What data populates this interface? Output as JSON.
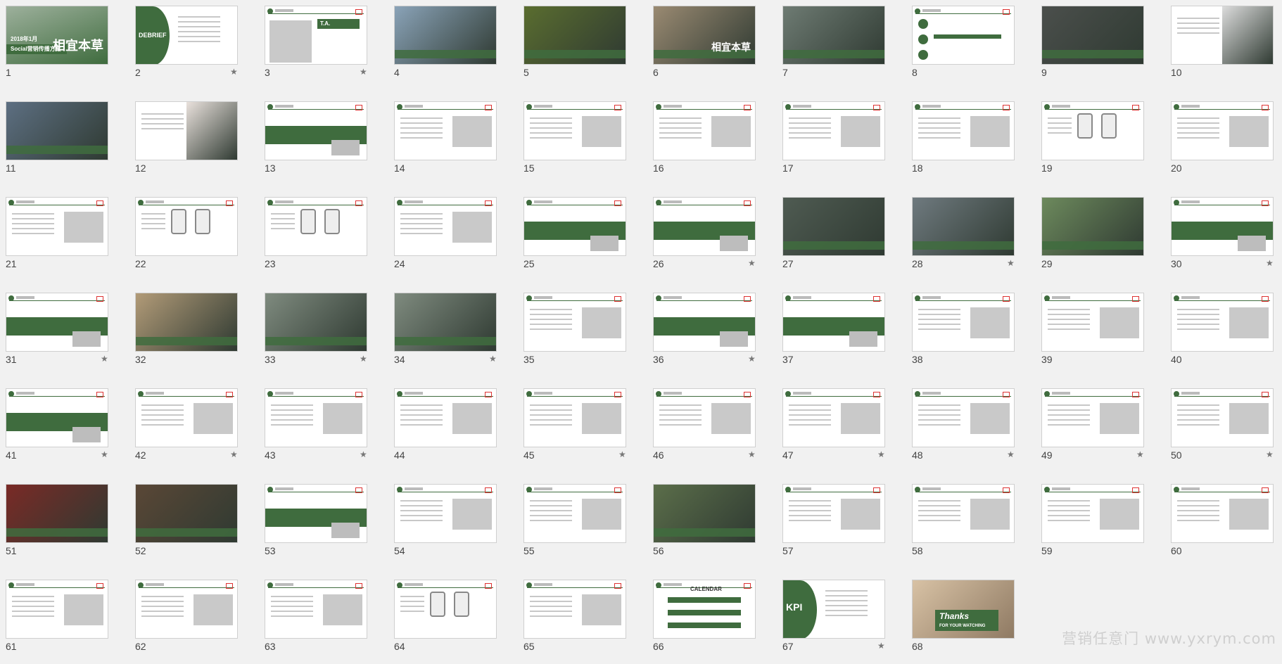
{
  "watermark": "营销任意门 www.yxrym.com",
  "colors": {
    "brand": "#3f6c3e",
    "page_bg": "#f1f1f1"
  },
  "slides": [
    {
      "n": "1",
      "star": false,
      "style": "cover",
      "text": "Social营销传播方案",
      "subtext": "2018年1月",
      "big": "相宜本草"
    },
    {
      "n": "2",
      "star": true,
      "style": "debrief",
      "text": "DEBRIEF"
    },
    {
      "n": "3",
      "star": true,
      "style": "ta",
      "text": "T.A."
    },
    {
      "n": "4",
      "star": false,
      "style": "photo",
      "bg": "#8aa3b8"
    },
    {
      "n": "5",
      "star": false,
      "style": "photo",
      "bg": "#5a6d2f"
    },
    {
      "n": "6",
      "star": false,
      "style": "photo",
      "bg": "#9a8a72",
      "big": "相宜本草"
    },
    {
      "n": "7",
      "star": false,
      "style": "photo",
      "bg": "#6e7b73"
    },
    {
      "n": "8",
      "star": false,
      "style": "diagram"
    },
    {
      "n": "9",
      "star": false,
      "style": "photo",
      "bg": "#4b4f4c"
    },
    {
      "n": "10",
      "star": false,
      "style": "text-photo",
      "bg": "#dcdcdc"
    },
    {
      "n": "11",
      "star": false,
      "style": "photo",
      "bg": "#5d6f82"
    },
    {
      "n": "12",
      "star": false,
      "style": "text-photo",
      "bg": "#e9e1dc"
    },
    {
      "n": "13",
      "star": false,
      "style": "band"
    },
    {
      "n": "14",
      "star": false,
      "style": "content"
    },
    {
      "n": "15",
      "star": false,
      "style": "content"
    },
    {
      "n": "16",
      "star": false,
      "style": "content"
    },
    {
      "n": "17",
      "star": false,
      "style": "content"
    },
    {
      "n": "18",
      "star": false,
      "style": "content"
    },
    {
      "n": "19",
      "star": false,
      "style": "phone"
    },
    {
      "n": "20",
      "star": false,
      "style": "content"
    },
    {
      "n": "21",
      "star": false,
      "style": "content"
    },
    {
      "n": "22",
      "star": false,
      "style": "phone"
    },
    {
      "n": "23",
      "star": false,
      "style": "phone"
    },
    {
      "n": "24",
      "star": false,
      "style": "content"
    },
    {
      "n": "25",
      "star": false,
      "style": "band"
    },
    {
      "n": "26",
      "star": true,
      "style": "band"
    },
    {
      "n": "27",
      "star": false,
      "style": "photo",
      "bg": "#4f5b52"
    },
    {
      "n": "28",
      "star": true,
      "style": "photo",
      "bg": "#6f7a7f"
    },
    {
      "n": "29",
      "star": false,
      "style": "photo",
      "bg": "#6d8a5d"
    },
    {
      "n": "30",
      "star": true,
      "style": "band"
    },
    {
      "n": "31",
      "star": true,
      "style": "band"
    },
    {
      "n": "32",
      "star": false,
      "style": "photo",
      "bg": "#b29b78"
    },
    {
      "n": "33",
      "star": true,
      "style": "photo",
      "bg": "#7f8b7f"
    },
    {
      "n": "34",
      "star": true,
      "style": "photo",
      "bg": "#7f8b7f"
    },
    {
      "n": "35",
      "star": false,
      "style": "content"
    },
    {
      "n": "36",
      "star": true,
      "style": "band"
    },
    {
      "n": "37",
      "star": false,
      "style": "band"
    },
    {
      "n": "38",
      "star": false,
      "style": "content"
    },
    {
      "n": "39",
      "star": false,
      "style": "content"
    },
    {
      "n": "40",
      "star": false,
      "style": "content"
    },
    {
      "n": "41",
      "star": true,
      "style": "band"
    },
    {
      "n": "42",
      "star": true,
      "style": "content"
    },
    {
      "n": "43",
      "star": true,
      "style": "content"
    },
    {
      "n": "44",
      "star": false,
      "style": "content"
    },
    {
      "n": "45",
      "star": true,
      "style": "content"
    },
    {
      "n": "46",
      "star": true,
      "style": "content"
    },
    {
      "n": "47",
      "star": true,
      "style": "content"
    },
    {
      "n": "48",
      "star": true,
      "style": "content"
    },
    {
      "n": "49",
      "star": true,
      "style": "content"
    },
    {
      "n": "50",
      "star": true,
      "style": "content"
    },
    {
      "n": "51",
      "star": false,
      "style": "photo",
      "bg": "#7a2a26"
    },
    {
      "n": "52",
      "star": false,
      "style": "photo",
      "bg": "#5a4736"
    },
    {
      "n": "53",
      "star": false,
      "style": "band"
    },
    {
      "n": "54",
      "star": false,
      "style": "content"
    },
    {
      "n": "55",
      "star": false,
      "style": "content"
    },
    {
      "n": "56",
      "star": false,
      "style": "photo",
      "bg": "#5b6e4a"
    },
    {
      "n": "57",
      "star": false,
      "style": "content"
    },
    {
      "n": "58",
      "star": false,
      "style": "content"
    },
    {
      "n": "59",
      "star": false,
      "style": "content"
    },
    {
      "n": "60",
      "star": false,
      "style": "content"
    },
    {
      "n": "61",
      "star": false,
      "style": "content"
    },
    {
      "n": "62",
      "star": false,
      "style": "content"
    },
    {
      "n": "63",
      "star": false,
      "style": "content"
    },
    {
      "n": "64",
      "star": false,
      "style": "phone"
    },
    {
      "n": "65",
      "star": false,
      "style": "content"
    },
    {
      "n": "66",
      "star": false,
      "style": "calendar",
      "text": "CALENDAR"
    },
    {
      "n": "67",
      "star": true,
      "style": "kpi",
      "text": "KPI"
    },
    {
      "n": "68",
      "star": false,
      "style": "thanks",
      "text": "Thanks",
      "subtext": "FOR YOUR WATCHING"
    }
  ]
}
